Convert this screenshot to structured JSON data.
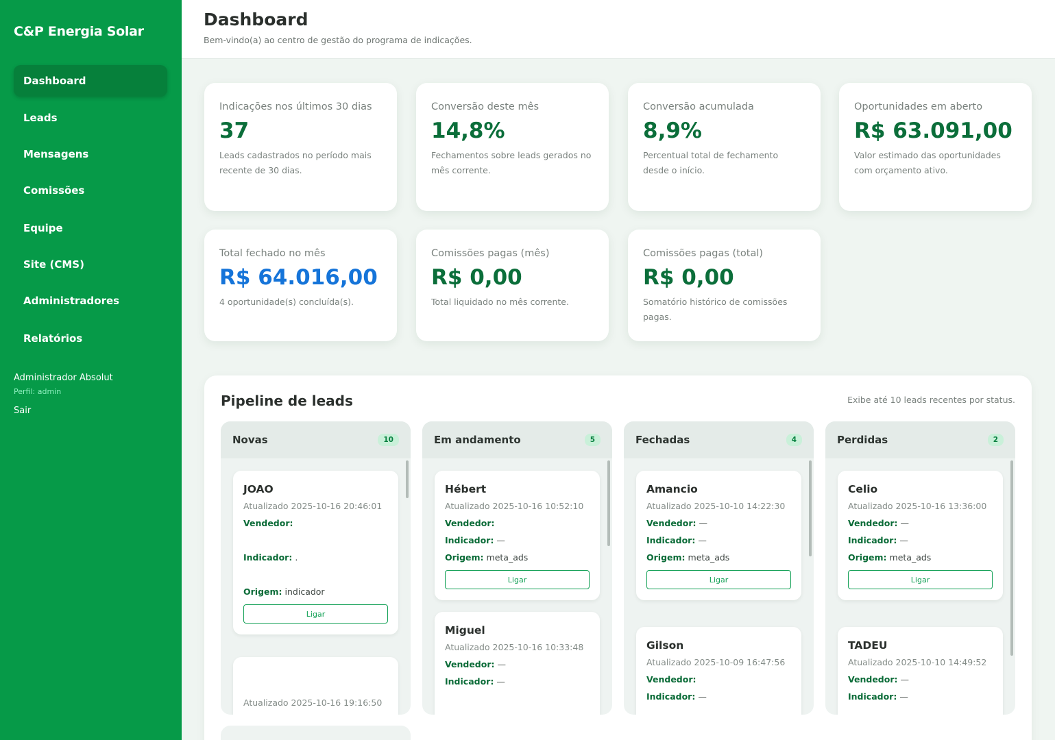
{
  "sidebar": {
    "brand": "C&P Energia Solar",
    "items": [
      {
        "label": "Dashboard"
      },
      {
        "label": "Leads"
      },
      {
        "label": "Mensagens"
      },
      {
        "label": "Comissões"
      },
      {
        "label": "Equipe"
      },
      {
        "label": "Site (CMS)"
      },
      {
        "label": "Administradores"
      },
      {
        "label": "Relatórios"
      }
    ],
    "active_item": "Dashboard",
    "user_name": "Administrador Absolut",
    "user_role": "Perfil: admin",
    "logout_label": "Sair"
  },
  "header": {
    "title": "Dashboard",
    "subtitle": "Bem-vindo(a) ao centro de gestão do programa de indicações."
  },
  "stats": [
    {
      "label": "Indicações nos últimos 30 dias",
      "value": "37",
      "desc": "Leads cadastrados no período mais recente de 30 dias."
    },
    {
      "label": "Conversão deste mês",
      "value": "14,8%",
      "desc": "Fechamentos sobre leads gerados no mês corrente."
    },
    {
      "label": "Conversão acumulada",
      "value": "8,9%",
      "desc": "Percentual total de fechamento desde o início."
    },
    {
      "label": "Oportunidades em aberto",
      "value": "R$ 63.091,00",
      "desc": "Valor estimado das oportunidades com orçamento ativo."
    },
    {
      "label": "Total fechado no mês",
      "value": "R$ 64.016,00",
      "desc": "4 oportunidade(s) concluída(s)."
    },
    {
      "label": "Comissões pagas (mês)",
      "value": "R$ 0,00",
      "desc": "Total liquidado no mês corrente."
    },
    {
      "label": "Comissões pagas (total)",
      "value": "R$ 0,00",
      "desc": "Somatório histórico de comissões pagas."
    }
  ],
  "colors": {
    "sidebar_bg": "#069a48",
    "value_green": "#0b6e3a",
    "value_blue": "#1574d9",
    "accent": "#12a055"
  },
  "pipeline": {
    "title": "Pipeline de leads",
    "note": "Exibe até 10 leads recentes por status.",
    "labels": {
      "seller": "Vendedor:",
      "referrer": "Indicador:",
      "origin": "Origem:",
      "call": "Ligar"
    },
    "columns": [
      {
        "title": "Novas",
        "count": "10",
        "leads": [
          {
            "name": "JOAO",
            "updated": "Atualizado 2025-10-16 20:46:01",
            "seller": "",
            "referrer": ".",
            "origin": "indicador"
          },
          {
            "name": "",
            "updated": "Atualizado 2025-10-16 19:16:50",
            "seller": ""
          }
        ]
      },
      {
        "title": "Em andamento",
        "count": "5",
        "leads": [
          {
            "name": "Hébert",
            "updated": "Atualizado 2025-10-16 10:52:10",
            "seller": "",
            "referrer": "—",
            "origin": "meta_ads"
          },
          {
            "name": "Miguel",
            "updated": "Atualizado 2025-10-16 10:33:48",
            "seller": "—",
            "referrer": "—"
          }
        ]
      },
      {
        "title": "Fechadas",
        "count": "4",
        "leads": [
          {
            "name": "Amancio",
            "updated": "Atualizado 2025-10-10 14:22:30",
            "seller": "—",
            "referrer": "—",
            "origin": "meta_ads"
          },
          {
            "name": "Gilson",
            "updated": "Atualizado 2025-10-09 16:47:56",
            "seller": "",
            "referrer": "—"
          }
        ]
      },
      {
        "title": "Perdidas",
        "count": "2",
        "leads": [
          {
            "name": "Celio",
            "updated": "Atualizado 2025-10-16 13:36:00",
            "seller": "—",
            "referrer": "—",
            "origin": "meta_ads"
          },
          {
            "name": "TADEU",
            "updated": "Atualizado 2025-10-10 14:49:52",
            "seller": "—",
            "referrer": "—"
          }
        ]
      }
    ]
  }
}
